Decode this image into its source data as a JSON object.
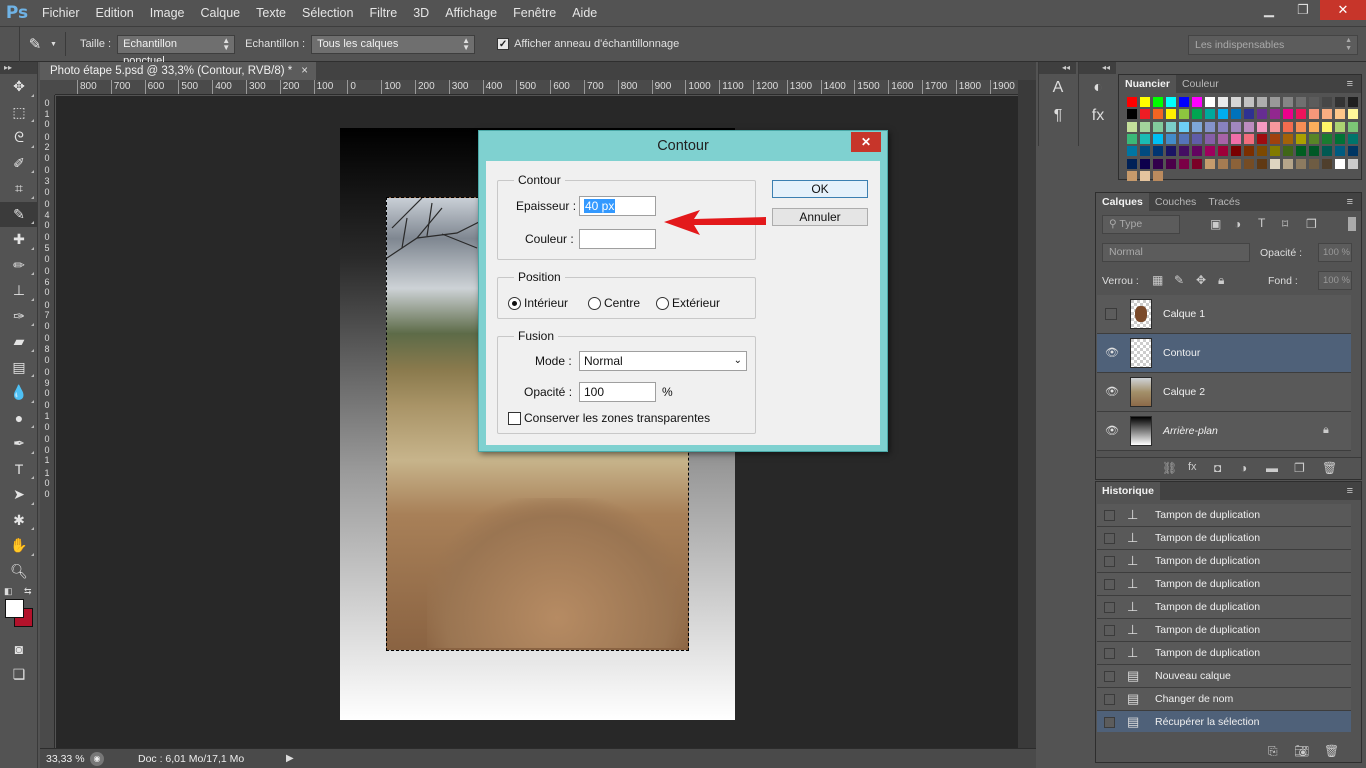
{
  "menubar": {
    "logo": "Ps",
    "items": [
      "Fichier",
      "Edition",
      "Image",
      "Calque",
      "Texte",
      "Sélection",
      "Filtre",
      "3D",
      "Affichage",
      "Fenêtre",
      "Aide"
    ]
  },
  "options": {
    "size_label": "Taille :",
    "size_value": "Echantillon ponctuel",
    "sample_label": "Echantillon :",
    "sample_value": "Tous les calques",
    "ring_checked": true,
    "ring_label": "Afficher anneau d'échantillonnage",
    "workspace": "Les indispensables"
  },
  "document": {
    "tab_title": "Photo étape 5.psd @ 33,3% (Contour, RVB/8) *",
    "close": "×",
    "ruler_h": [
      "800",
      "700",
      "600",
      "500",
      "400",
      "300",
      "200",
      "100",
      "0",
      "100",
      "200",
      "300",
      "400",
      "500",
      "600",
      "700",
      "800",
      "900",
      "1000",
      "1100",
      "1200",
      "1300",
      "1400",
      "1500",
      "1600",
      "1700",
      "1800",
      "1900",
      "20"
    ],
    "ruler_v": [
      "0",
      "1",
      "0",
      "0",
      "2",
      "0",
      "0",
      "3",
      "0",
      "0",
      "4",
      "0",
      "0",
      "5",
      "0",
      "0",
      "6",
      "0",
      "0",
      "7",
      "0",
      "0",
      "8",
      "0",
      "0",
      "9",
      "0",
      "0",
      "1",
      "0",
      "0",
      "0",
      "1",
      "1",
      "0",
      "0"
    ],
    "zoom": "33,33 %",
    "doc_info": "Doc : 6,01 Mo/17,1 Mo"
  },
  "dialog": {
    "title": "Contour",
    "close": "✕",
    "group_contour": "Contour",
    "thickness_label": "Epaisseur :",
    "thickness_value": "40 px",
    "color_label": "Couleur :",
    "ok": "OK",
    "cancel": "Annuler",
    "group_position": "Position",
    "positions": [
      "Intérieur",
      "Centre",
      "Extérieur"
    ],
    "selected_position": "Intérieur",
    "group_fusion": "Fusion",
    "mode_label": "Mode :",
    "mode_value": "Normal",
    "opacity_label": "Opacité :",
    "opacity_value": "100",
    "opacity_unit": "%",
    "preserve_label": "Conserver les zones transparentes",
    "preserve_checked": false
  },
  "swatches_panel": {
    "tabs": [
      "Nuancier",
      "Couleur"
    ],
    "active": "Nuancier"
  },
  "layers_panel": {
    "tabs": [
      "Calques",
      "Couches",
      "Tracés"
    ],
    "active": "Calques",
    "filter": "Type",
    "blend": "Normal",
    "opacity_label": "Opacité :",
    "opacity_value": "100 %",
    "lock_label": "Verrou :",
    "fill_label": "Fond :",
    "fill_value": "100 %",
    "layers": [
      {
        "name": "Calque 1",
        "visible": false,
        "selected": false
      },
      {
        "name": "Contour",
        "visible": true,
        "selected": true
      },
      {
        "name": "Calque 2",
        "visible": true,
        "selected": false
      },
      {
        "name": "Arrière-plan",
        "visible": true,
        "selected": false,
        "locked": true
      }
    ]
  },
  "history_panel": {
    "title": "Historique",
    "items": [
      "Tampon de duplication",
      "Tampon de duplication",
      "Tampon de duplication",
      "Tampon de duplication",
      "Tampon de duplication",
      "Tampon de duplication",
      "Tampon de duplication",
      "Nouveau calque",
      "Changer de nom",
      "Récupérer la sélection"
    ],
    "selected_index": 9
  },
  "colors": {
    "ui_bg": "#535353",
    "dialog_frame": "#7fd1d0",
    "selection_blue": "#4f6179",
    "arrow_red": "#e3191b",
    "foreground": "#ffffff",
    "background": "#b3122b"
  }
}
